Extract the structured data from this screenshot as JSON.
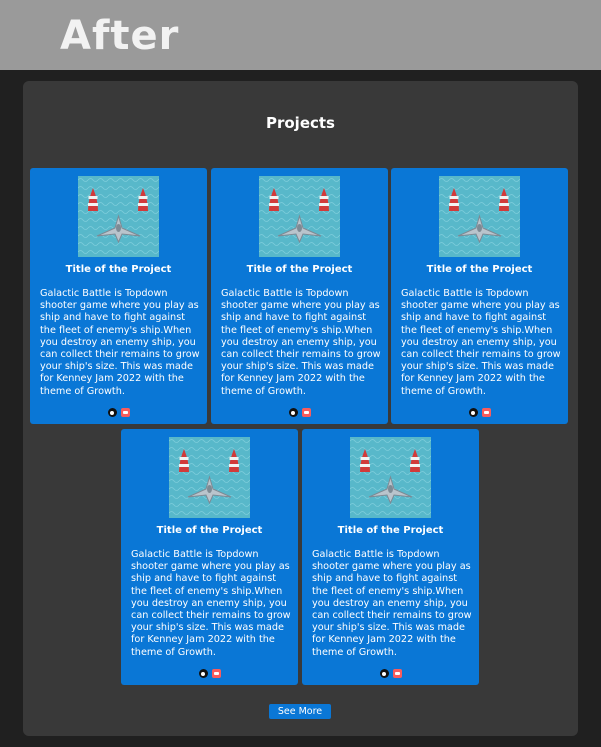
{
  "banner": {
    "label": "After"
  },
  "section": {
    "title": "Projects"
  },
  "projects": [
    {
      "title": "Title of the Project",
      "description": "Galactic Battle is Topdown shooter game where you play as ship and have to fight against the fleet of enemy's ship.When you destroy an enemy ship, you can collect their remains to grow your ship's size. This was made for Kenney Jam 2022 with the theme of Growth.",
      "icons": [
        "github-icon",
        "itch-icon"
      ]
    },
    {
      "title": "Title of the Project",
      "description": "Galactic Battle is Topdown shooter game where you play as ship and have to fight against the fleet of enemy's ship.When you destroy an enemy ship, you can collect their remains to grow your ship's size. This was made for Kenney Jam 2022 with the theme of Growth.",
      "icons": [
        "github-icon",
        "itch-icon"
      ]
    },
    {
      "title": "Title of the Project",
      "description": "Galactic Battle is Topdown shooter game where you play as ship and have to fight against the fleet of enemy's ship.When you destroy an enemy ship, you can collect their remains to grow your ship's size. This was made for Kenney Jam 2022 with the theme of Growth.",
      "icons": [
        "github-icon",
        "itch-icon"
      ]
    },
    {
      "title": "Title of the Project",
      "description": "Galactic Battle is Topdown shooter game where you play as ship and have to fight against the fleet of enemy's ship.When you destroy an enemy ship, you can collect their remains to grow your ship's size. This was made for Kenney Jam 2022 with the theme of Growth.",
      "icons": [
        "github-icon",
        "itch-icon"
      ]
    },
    {
      "title": "Title of the Project",
      "description": "Galactic Battle is Topdown shooter game where you play as ship and have to fight against the fleet of enemy's ship.When you destroy an enemy ship, you can collect their remains to grow your ship's size. This was made for Kenney Jam 2022 with the theme of Growth.",
      "icons": [
        "github-icon",
        "itch-icon"
      ]
    }
  ],
  "actions": {
    "see_more": "See More"
  },
  "colors": {
    "card": "#0a77d6",
    "panel": "#393939",
    "page": "#202020",
    "banner": "#9a9a9a"
  }
}
